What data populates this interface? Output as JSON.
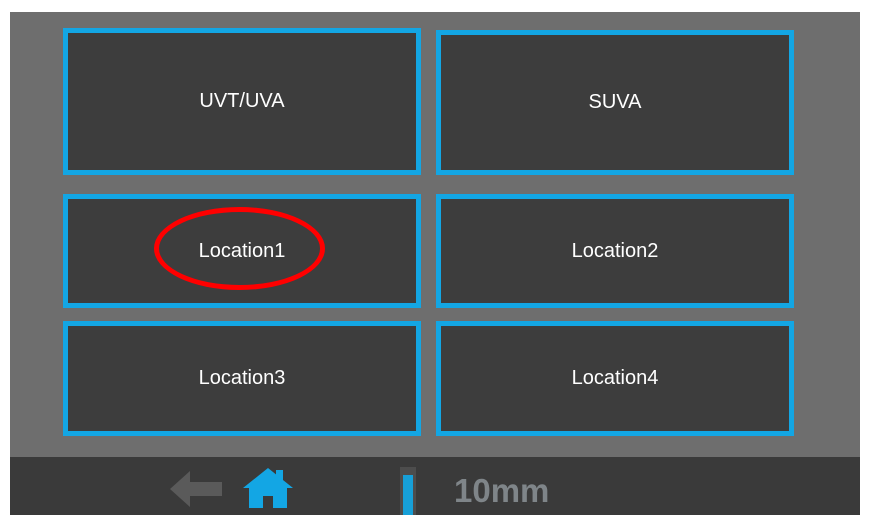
{
  "buttons": [
    {
      "label": "UVT/UVA"
    },
    {
      "label": "SUVA"
    },
    {
      "label": "Location1"
    },
    {
      "label": "Location2"
    },
    {
      "label": "Location3"
    },
    {
      "label": "Location4"
    }
  ],
  "bottom_bar": {
    "depth_label": "10mm",
    "icons": [
      "back-arrow-icon",
      "home-icon",
      "cuvette-icon"
    ]
  },
  "colors": {
    "screen_bg": "#6e6e6e",
    "button_bg": "#3d3d3d",
    "button_border": "#13a6e4",
    "highlight": "#ff0000",
    "bar_bg": "#3a3a3a",
    "home_icon": "#13a6e4",
    "back_icon": "#5a5a5a"
  }
}
